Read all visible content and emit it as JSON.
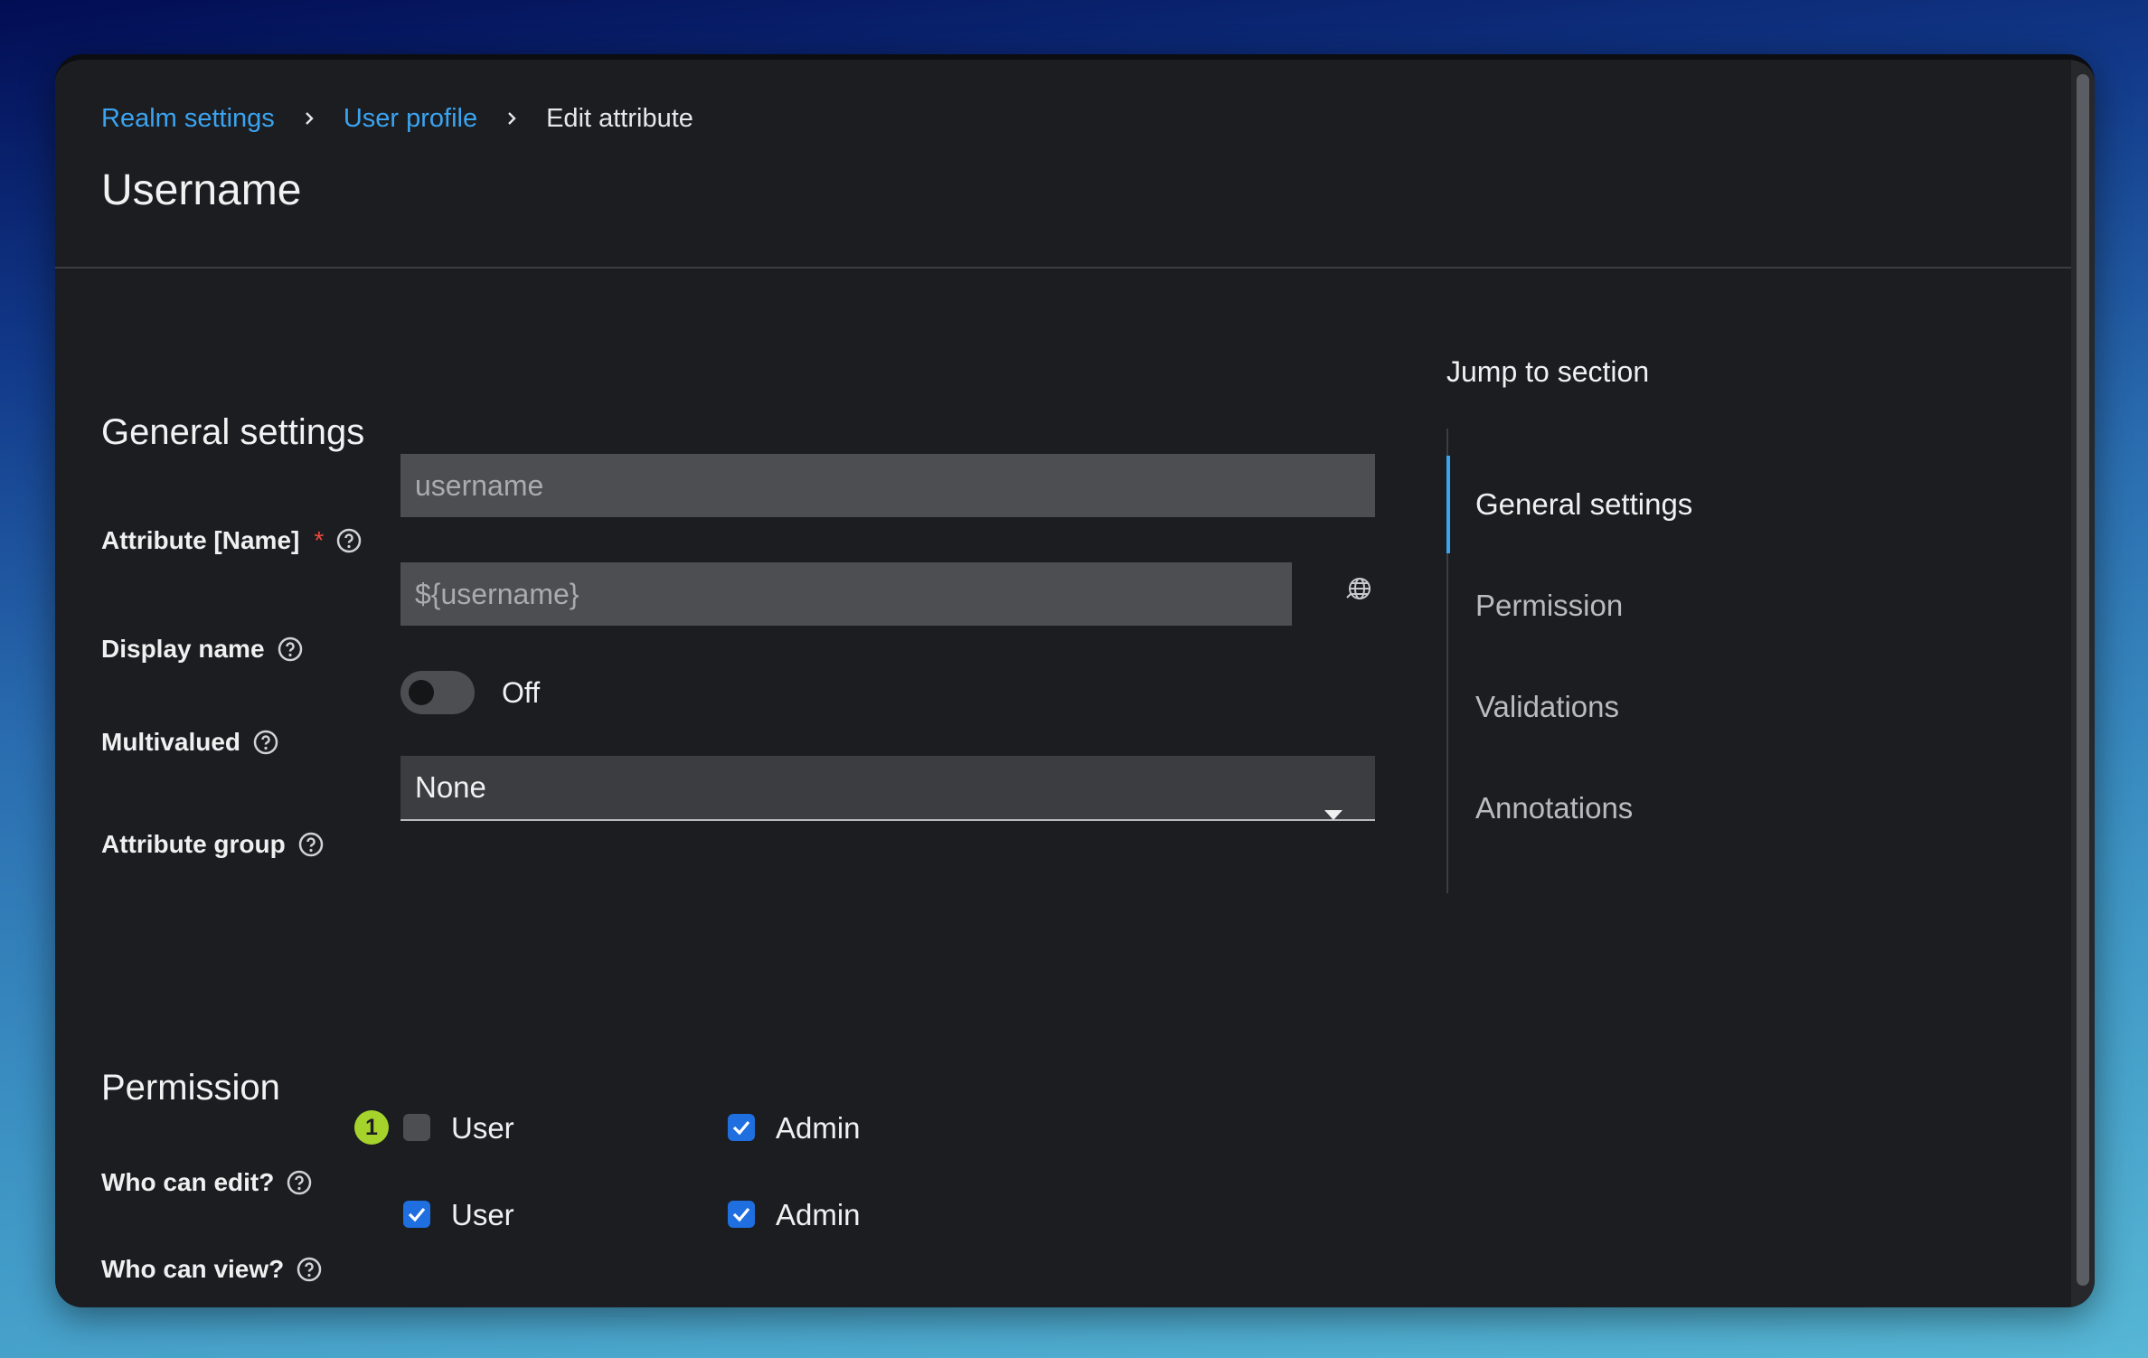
{
  "breadcrumb": {
    "items": [
      {
        "label": "Realm settings"
      },
      {
        "label": "User profile"
      },
      {
        "label": "Edit attribute"
      }
    ]
  },
  "page": {
    "title": "Username"
  },
  "general": {
    "title": "General settings",
    "attribute_name": {
      "label": "Attribute [Name]",
      "required_mark": "*",
      "value": "username"
    },
    "display_name": {
      "label": "Display name",
      "value": "${username}"
    },
    "multivalued": {
      "label": "Multivalued",
      "state": "Off",
      "enabled": false
    },
    "attribute_group": {
      "label": "Attribute group",
      "selected": "None"
    }
  },
  "permission": {
    "title": "Permission",
    "who_can_edit": {
      "label": "Who can edit?",
      "badge": "1",
      "user": {
        "label": "User",
        "checked": false
      },
      "admin": {
        "label": "Admin",
        "checked": true
      }
    },
    "who_can_view": {
      "label": "Who can view?",
      "user": {
        "label": "User",
        "checked": true
      },
      "admin": {
        "label": "Admin",
        "checked": true
      }
    }
  },
  "jump": {
    "title": "Jump to section",
    "items": [
      {
        "label": "General settings",
        "active": true
      },
      {
        "label": "Permission",
        "active": false
      },
      {
        "label": "Validations",
        "active": false
      },
      {
        "label": "Annotations",
        "active": false
      }
    ]
  },
  "colors": {
    "link": "#3ba4f0",
    "checkbox": "#1f6fe0",
    "badge": "#a6d32b",
    "required": "#f0493c"
  },
  "icons": [
    "chevron-right-icon",
    "help-icon",
    "globe-icon",
    "caret-down-icon",
    "checkmark-icon"
  ]
}
